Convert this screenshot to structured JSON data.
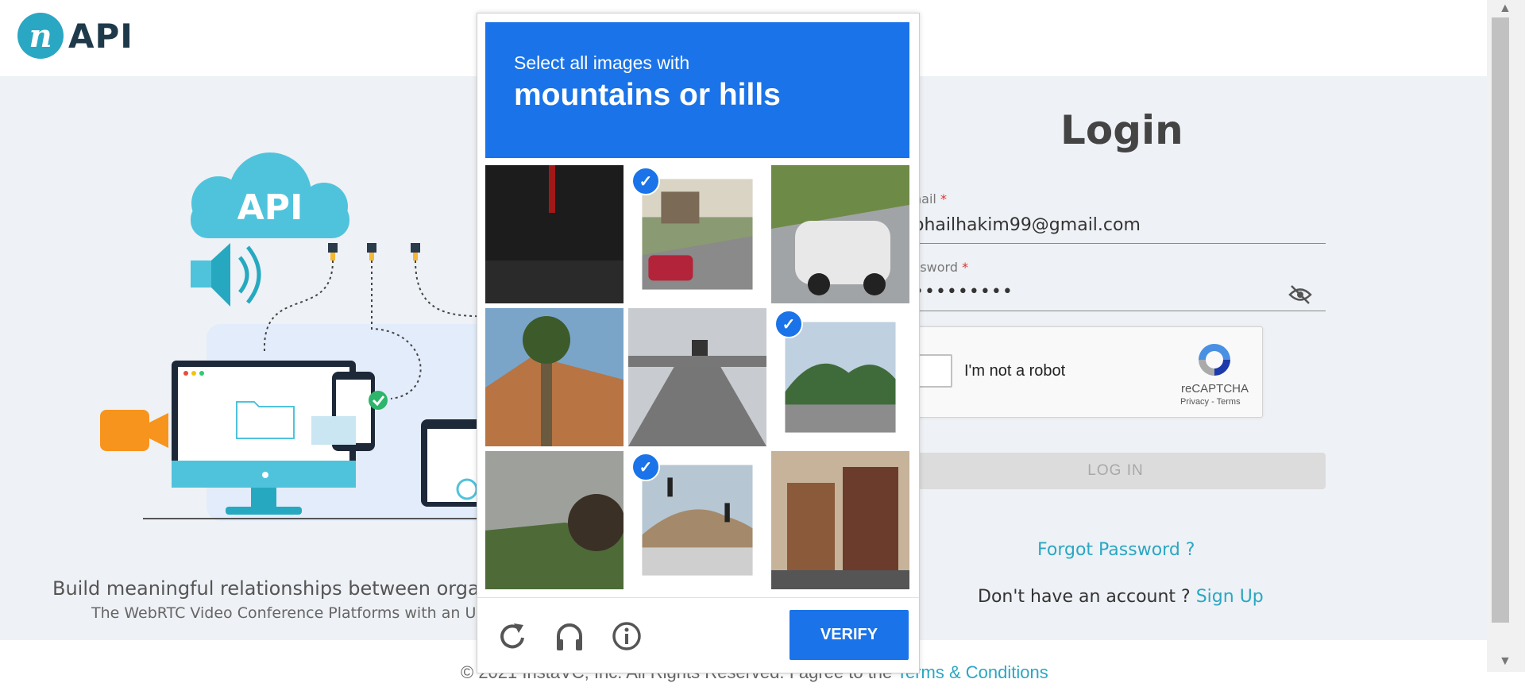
{
  "header": {
    "logo_mark": "n",
    "logo_text": "API"
  },
  "illustration": {
    "cloud_label": "API"
  },
  "hero": {
    "tagline": "Build meaningful relationships between orga",
    "subtagline": "The WebRTC Video Conference Platforms with an Un"
  },
  "login": {
    "title": "Login",
    "email_label": "nail",
    "email_value": "ohailhakim99@gmail.com",
    "password_label": "ssword",
    "password_value": "•••••••••",
    "required_mark": "*",
    "login_button": "LOG IN",
    "forgot": "Forgot Password ?",
    "no_account": "Don't have an account ? ",
    "signup": "Sign Up"
  },
  "recaptcha": {
    "label": "I'm not a robot",
    "brand": "reCAPTCHA",
    "privacy": "Privacy",
    "sep": " - ",
    "terms": "Terms"
  },
  "challenge": {
    "instruction": "Select all images with",
    "target": "mountains or hills",
    "verify": "VERIFY",
    "tiles": [
      {
        "scene": "dark sign",
        "selected": false
      },
      {
        "scene": "suburban street with red car",
        "selected": true
      },
      {
        "scene": "white suv on road",
        "selected": false
      },
      {
        "scene": "palm tree and house",
        "selected": false
      },
      {
        "scene": "road with traffic lights",
        "selected": false
      },
      {
        "scene": "town with green hills",
        "selected": true
      },
      {
        "scene": "hill with tree",
        "selected": false
      },
      {
        "scene": "intersection with hill",
        "selected": true
      },
      {
        "scene": "city buildings",
        "selected": false
      }
    ],
    "check_glyph": "✓"
  },
  "footer": {
    "text": "© 2021 InstaVC, Inc. All Rights Reserved. I agree to the ",
    "link": "Terms & Conditions"
  },
  "scrollbar": {
    "up": "▲",
    "down": "▼"
  },
  "colors": {
    "accent": "#2aa7c3",
    "captcha_blue": "#1a73e8",
    "background": "#eef1f5"
  },
  "icons": [
    "reload-icon",
    "headphones-icon",
    "info-icon",
    "eye-off-icon",
    "check-icon"
  ]
}
